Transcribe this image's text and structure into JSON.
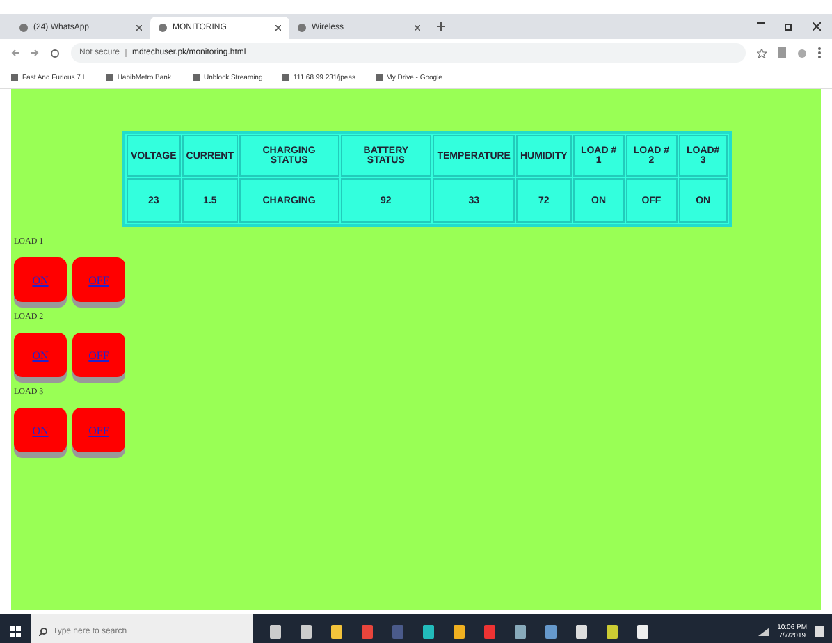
{
  "browser": {
    "tabs": [
      {
        "title": "(24) WhatsApp",
        "selected": false
      },
      {
        "title": "MONITORING",
        "selected": true
      },
      {
        "title": "Wireless",
        "selected": false
      }
    ],
    "address": {
      "security": "Not secure",
      "url": "mdtechuser.pk/monitoring.html"
    },
    "bookmarks": [
      "Fast And Furious 7 L...",
      "HabibMetro Bank ...",
      "Unblock Streaming...",
      "111.68.99.231/jpeas...",
      "My Drive - Google..."
    ]
  },
  "table": {
    "columns": [
      "VOLTAGE",
      "CURRENT",
      "CHARGING STATUS",
      "BATTERY STATUS",
      "TEMPERATURE",
      "HUMIDITY",
      "LOAD # 1",
      "LOAD # 2",
      "LOAD# 3"
    ],
    "rows": [
      [
        "23",
        "1.5",
        "CHARGING",
        "92",
        "33",
        "72",
        "ON",
        "OFF",
        "ON"
      ]
    ]
  },
  "loads": [
    {
      "label": "LOAD 1",
      "buttons": [
        "ON",
        "OFF"
      ]
    },
    {
      "label": "LOAD 2",
      "buttons": [
        "ON",
        "OFF"
      ]
    },
    {
      "label": "LOAD 3",
      "buttons": [
        "ON",
        "OFF"
      ]
    }
  ],
  "taskbar": {
    "search": {
      "placeholder": "Type here to search"
    },
    "time": "10:06 PM",
    "date": "7/7/2019"
  }
}
